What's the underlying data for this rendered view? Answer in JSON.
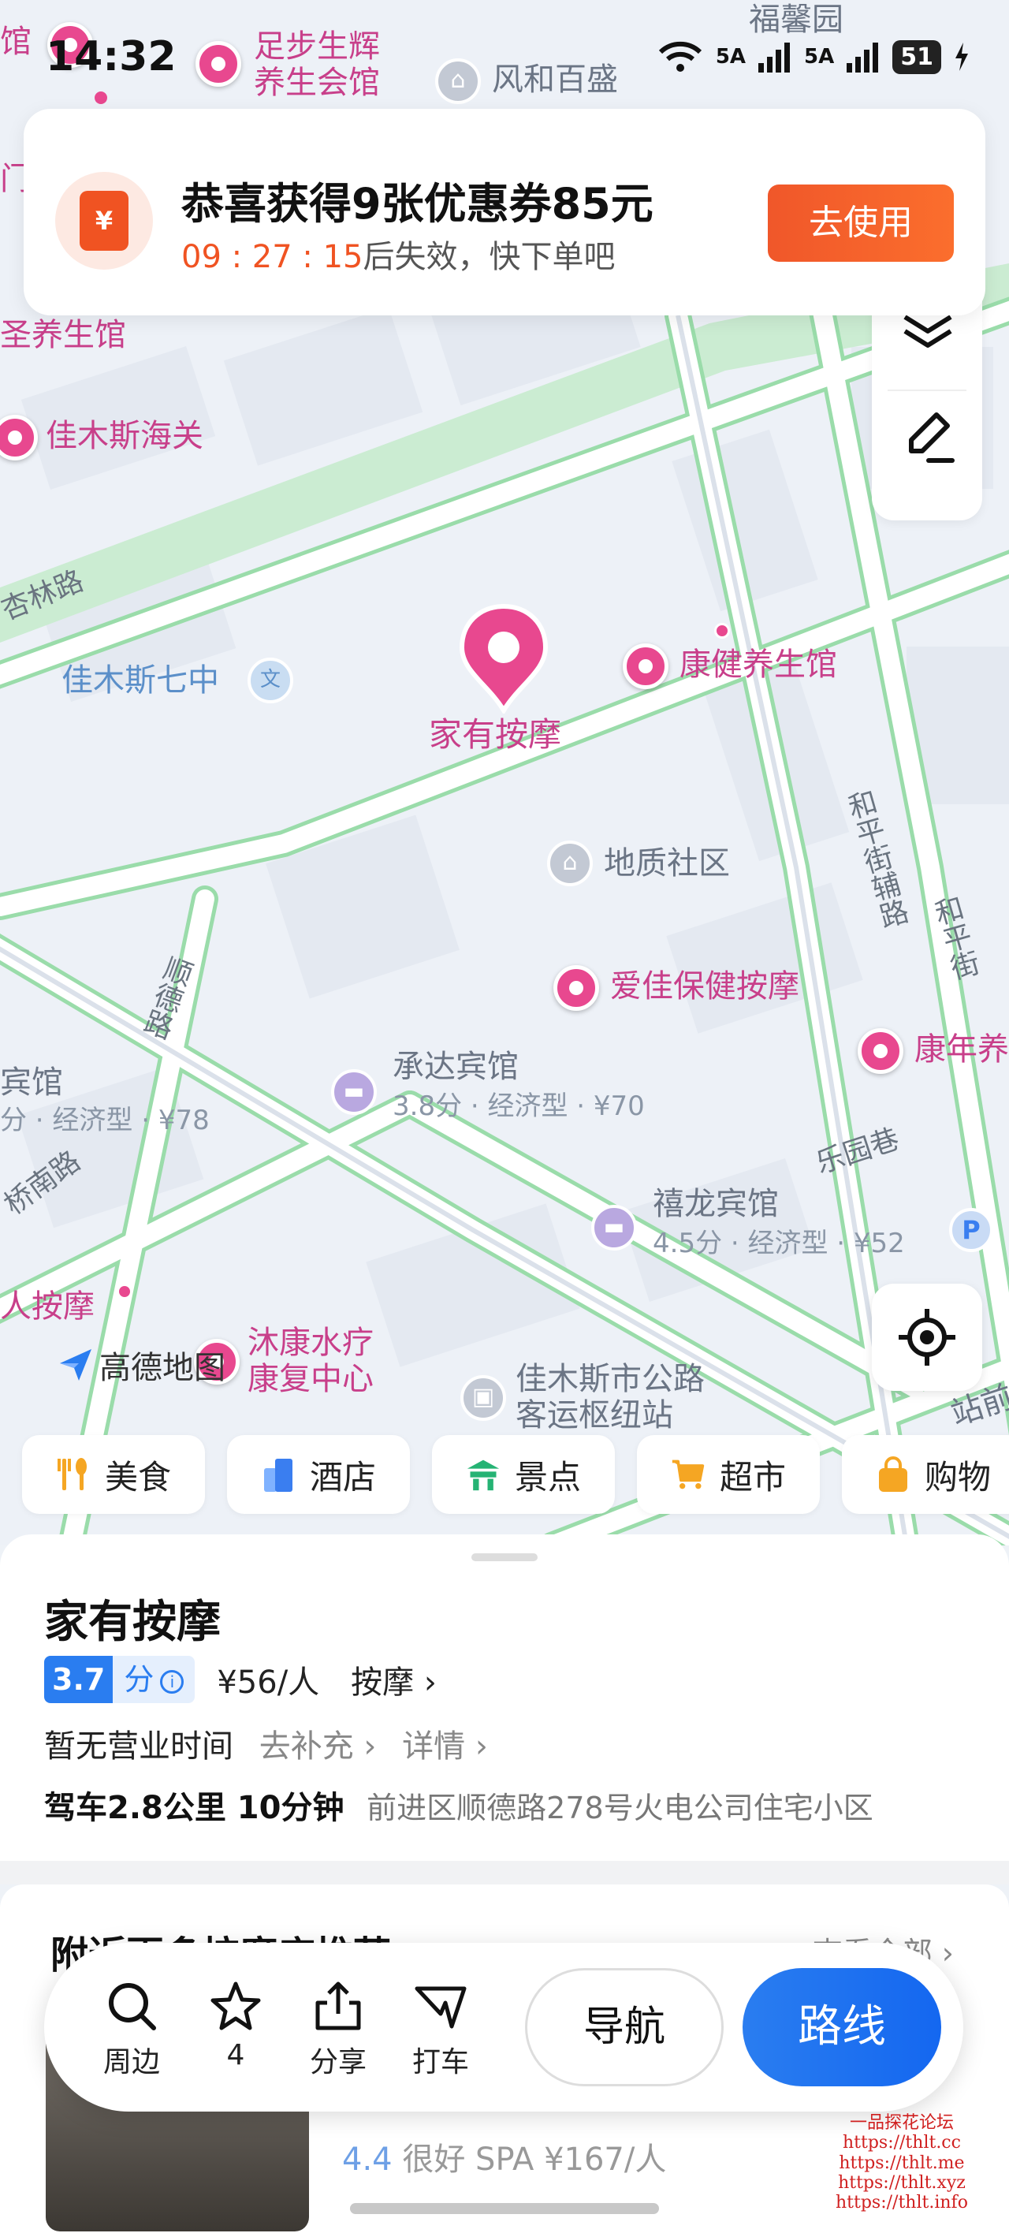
{
  "status_bar": {
    "time": "14:32",
    "net1": "5A",
    "net2": "5A",
    "battery": "51"
  },
  "coupon": {
    "icon_glyph": "¥",
    "title": "恭喜获得9张优惠券85元",
    "timer": "09 : 27 : 15",
    "suffix": "后失效，快下单吧",
    "button": "去使用"
  },
  "map": {
    "labels": {
      "zubu": "足步生辉\n养生会馆",
      "fenghe": "风和百盛",
      "fuxin": "福馨园",
      "guan": "馆",
      "men": "门",
      "yangsheng_left": "圣养生馆",
      "jiamusi_customs": "佳木斯海关",
      "xinglin_road": "杏林路",
      "seventh_school": "佳木斯七中",
      "edu_icon": "文",
      "kangjian": "康健养生馆",
      "main_pin_label": "家有按摩",
      "dizhi": "地质社区",
      "heping_aux": "和平街辅路",
      "heping": "和平街",
      "aijia": "爱佳保健按摩",
      "kangnian": "康年养",
      "shunde_road": "顺德路",
      "chengda": "承达宾馆",
      "chengda_sub": "3.8分 · 经济型 · ¥70",
      "binguan_left": "宾馆",
      "binguan_left_sub": "分 · 经济型 · ¥78",
      "leyuan": "乐园巷",
      "xilong": "禧龙宾馆",
      "xilong_sub": "4.5分 · 经济型 · ¥52",
      "qiaonan_road": "桥南路",
      "ren_anmo": "人按摩",
      "mukang": "沐康水疗\n康复中心",
      "bus_hub": "佳木斯市公路\n客运枢纽站",
      "zhan": "站前",
      "parking": "P"
    },
    "logo": "高德地图"
  },
  "chips": [
    {
      "label": "美食",
      "icon": "fork-spoon-icon",
      "color": "#f5a623"
    },
    {
      "label": "酒店",
      "icon": "hotel-icon",
      "color": "#3a7ef0"
    },
    {
      "label": "景点",
      "icon": "scenic-icon",
      "color": "#25b374"
    },
    {
      "label": "超市",
      "icon": "cart-icon",
      "color": "#f5a623"
    },
    {
      "label": "购物",
      "icon": "bag-icon",
      "color": "#f5a623"
    }
  ],
  "place": {
    "name": "家有按摩",
    "rating": "3.7",
    "rating_unit": "分",
    "price": "¥56/人",
    "category": "按摩",
    "hours": "暂无营业时间",
    "supplement": "去补充",
    "details": "详情",
    "drive": "驾车2.8公里  10分钟",
    "address": "前进区顺德路278号火电公司住宅小区"
  },
  "recommend": {
    "title": "附近更多按摩店推荐",
    "view_all": "查看全部",
    "item_score": "4.4",
    "item_meta": "很好  SPA   ¥167/人"
  },
  "actions": {
    "nearby": "周边",
    "favorites": "4",
    "share": "分享",
    "taxi": "打车",
    "navigate": "导航",
    "route": "路线"
  },
  "watermark": [
    "一品探花论坛",
    "https://thlt.cc",
    "https://thlt.me",
    "https://thlt.xyz",
    "https://thlt.info"
  ]
}
